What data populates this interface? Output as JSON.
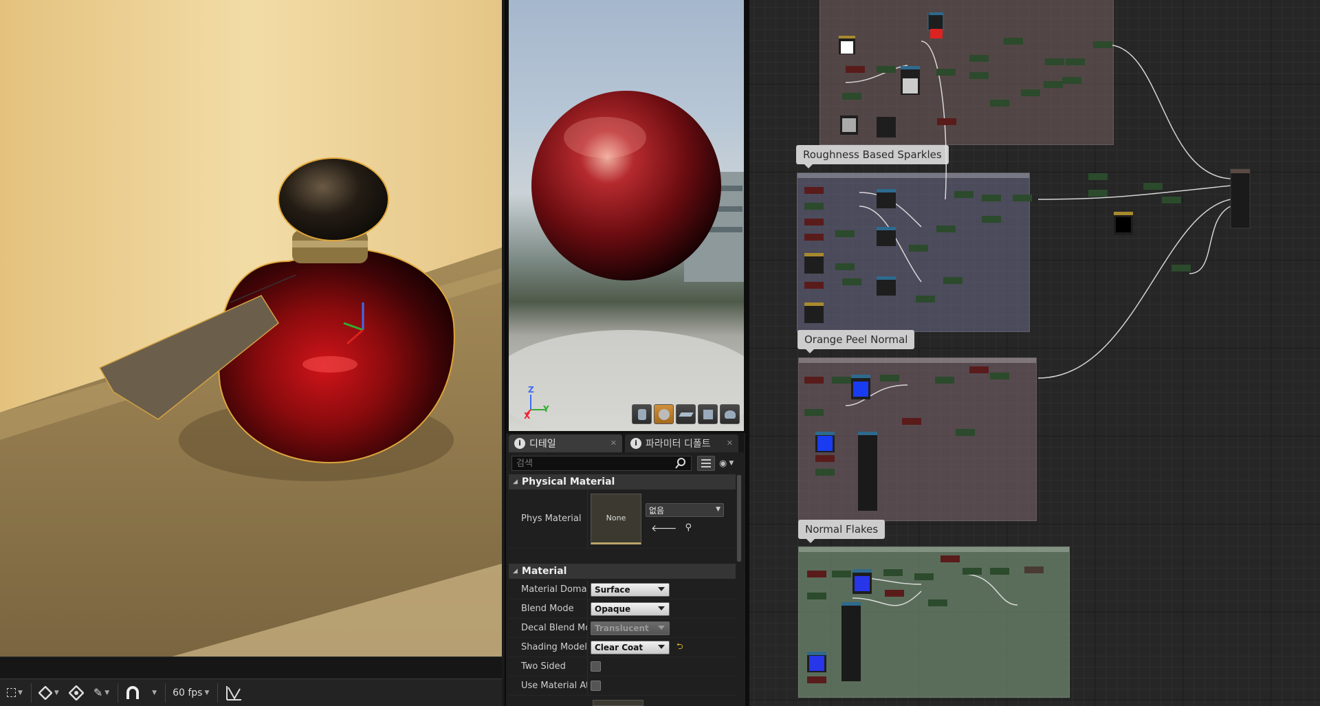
{
  "viewport": {
    "toolbar": {
      "fps_label": "60 fps"
    }
  },
  "preview": {
    "axis_x": "X",
    "axis_y": "Y",
    "axis_z": "Z"
  },
  "details": {
    "tabs": [
      {
        "label": "디테일",
        "icon": "details-icon"
      },
      {
        "label": "파라미터 디폴트",
        "icon": "parameters-icon"
      }
    ],
    "search": {
      "placeholder": "검색"
    },
    "physical_material": {
      "header": "Physical Material",
      "phys_material_label": "Phys Material",
      "thumbnail_text": "None",
      "asset_combo": "없음"
    },
    "material": {
      "header": "Material",
      "rows": [
        {
          "label": "Material Domain",
          "value": "Surface"
        },
        {
          "label": "Blend Mode",
          "value": "Opaque"
        },
        {
          "label": "Decal Blend Mod",
          "value": "Translucent"
        },
        {
          "label": "Shading Model",
          "value": "Clear Coat"
        },
        {
          "label": "Two Sided",
          "value": ""
        },
        {
          "label": "Use Material Att",
          "value": ""
        }
      ]
    }
  },
  "graph": {
    "comments": [
      {
        "title": "Roughness Based Sparkles"
      },
      {
        "title": "Orange Peel Normal"
      },
      {
        "title": "Normal Flakes"
      }
    ]
  },
  "colors": {
    "accent_orange": "#c8892d",
    "bottle_red": "#8e0c0e",
    "comment_brown": "#5b4a4a",
    "comment_blue": "#51515f",
    "comment_green": "#5d6b5d"
  }
}
